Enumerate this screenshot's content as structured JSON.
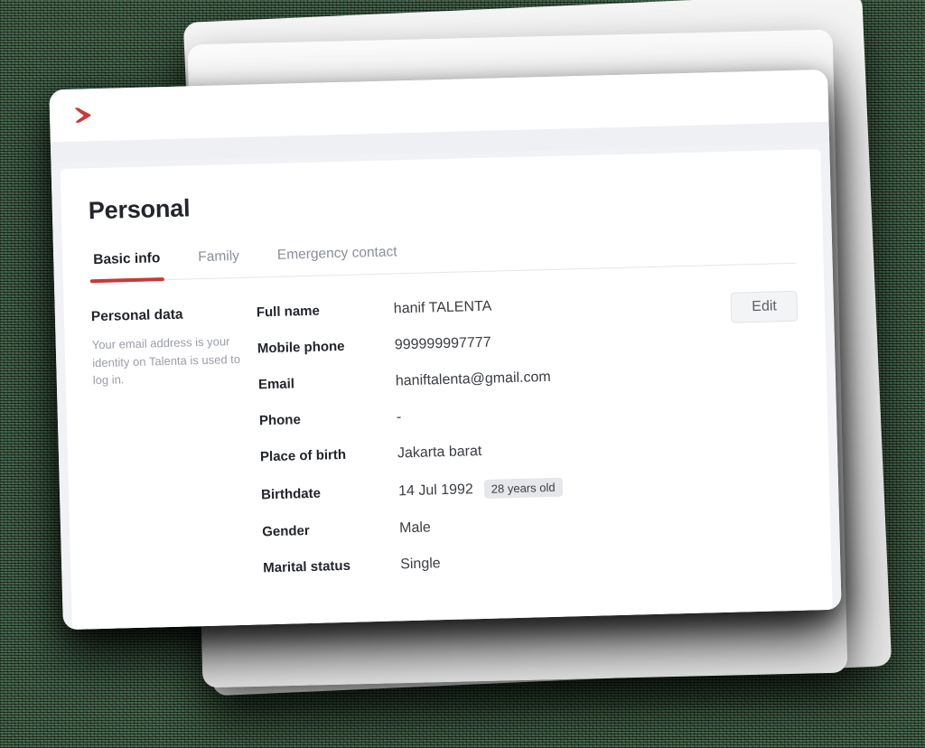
{
  "app": {
    "logo_name": "talenta-chevron-logo",
    "brand_red": "#c73a3a"
  },
  "page": {
    "title": "Personal"
  },
  "tabs": [
    {
      "label": "Basic info",
      "active": true
    },
    {
      "label": "Family",
      "active": false
    },
    {
      "label": "Emergency contact",
      "active": false
    }
  ],
  "section": {
    "heading": "Personal data",
    "description": "Your email address is your identity on Talenta is used to log in."
  },
  "actions": {
    "edit_label": "Edit"
  },
  "fields": [
    {
      "label": "Full name",
      "value": "hanif TALENTA"
    },
    {
      "label": "Mobile phone",
      "value": "999999997777"
    },
    {
      "label": "Email",
      "value": "haniftalenta@gmail.com"
    },
    {
      "label": "Phone",
      "value": "-"
    },
    {
      "label": "Place of birth",
      "value": "Jakarta barat"
    },
    {
      "label": "Birthdate",
      "value": "14 Jul 1992",
      "badge": "28 years old"
    },
    {
      "label": "Gender",
      "value": "Male"
    },
    {
      "label": "Marital status",
      "value": "Single"
    }
  ]
}
